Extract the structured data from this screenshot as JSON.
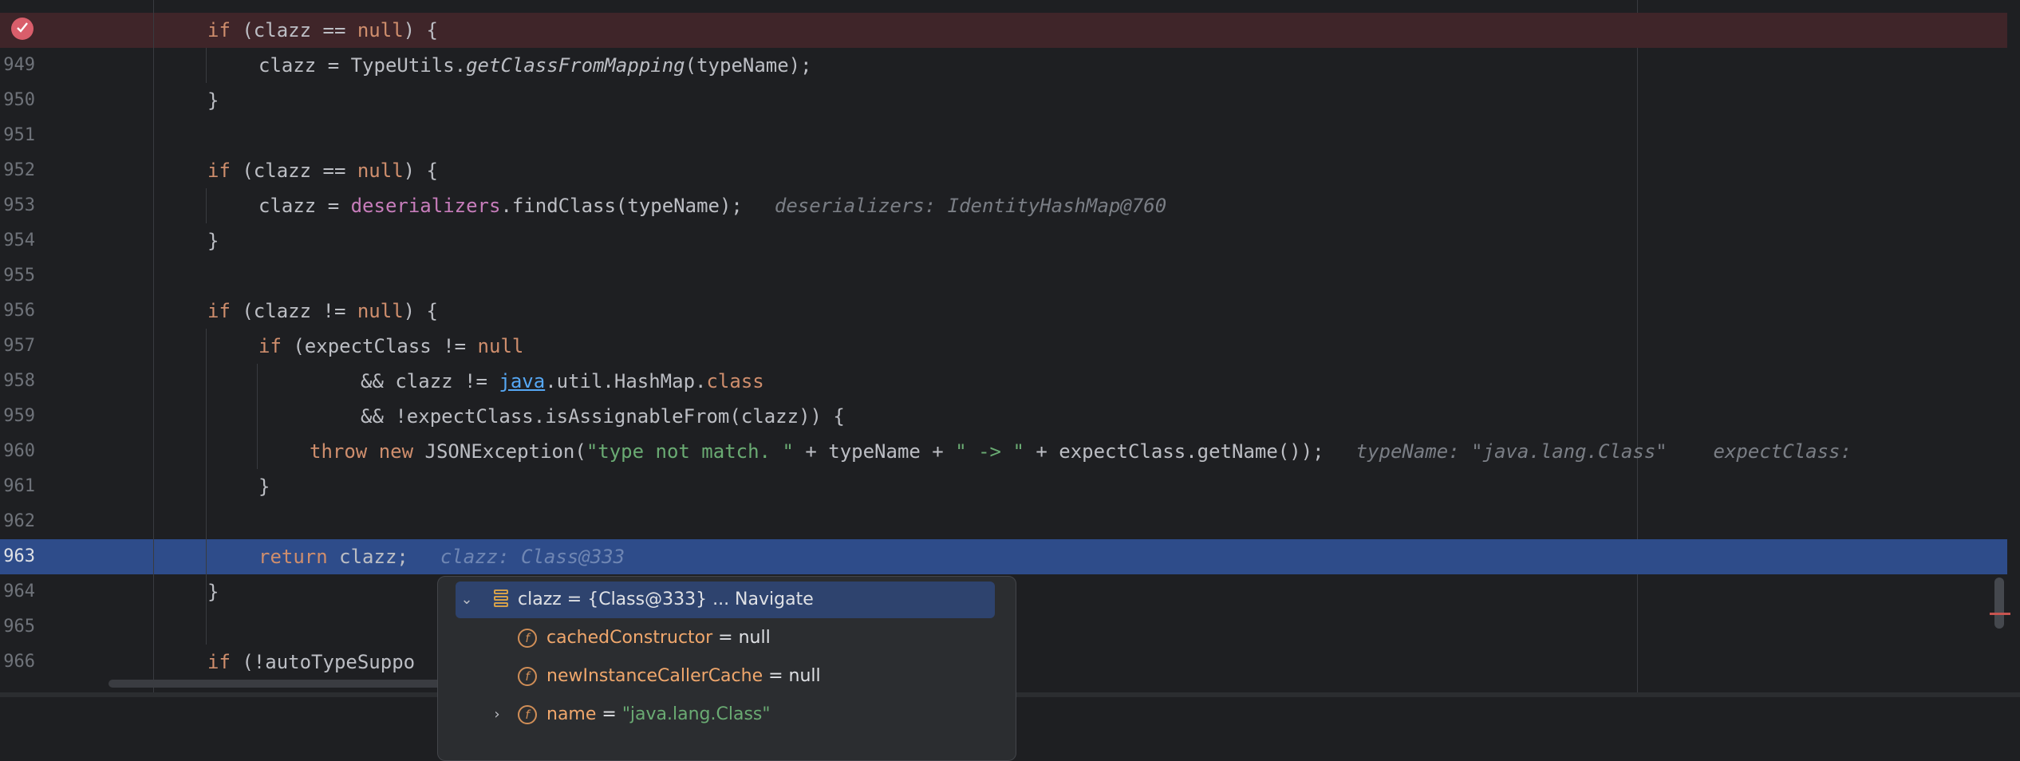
{
  "editor": {
    "lines": [
      {
        "num": "",
        "breakpoint": true
      },
      {
        "num": "949"
      },
      {
        "num": "950"
      },
      {
        "num": "951"
      },
      {
        "num": "952"
      },
      {
        "num": "953"
      },
      {
        "num": "954"
      },
      {
        "num": "955"
      },
      {
        "num": "956"
      },
      {
        "num": "957"
      },
      {
        "num": "958"
      },
      {
        "num": "959"
      },
      {
        "num": "960"
      },
      {
        "num": "961"
      },
      {
        "num": "962"
      },
      {
        "num": "963",
        "execution_point": true
      },
      {
        "num": "964"
      },
      {
        "num": "965"
      },
      {
        "num": "966"
      }
    ],
    "code": {
      "if_kw": "if",
      "return_kw": "return",
      "throw_kw": "throw",
      "new_kw": "new",
      "null_kw": "null",
      "class_kw": "class",
      "l948_rest": "(clazz == ",
      "l948_end": ") {",
      "l949_a": "clazz = TypeUtils.",
      "l949_method": "getClassFromMapping",
      "l949_b": "(typeName);",
      "brace_close": "}",
      "l952_rest": "(clazz == ",
      "l952_end": ") {",
      "l953_a": "clazz = ",
      "l953_field": "deserializers",
      "l953_b": ".findClass(typeName);",
      "l953_hint": "deserializers: IdentityHashMap@760",
      "l956_rest": "(clazz != ",
      "l956_end": ") {",
      "l957_rest": "(expectClass != ",
      "l958_a": "&& clazz != ",
      "l958_link": "java",
      "l958_b": ".util.HashMap.",
      "l959": "&& !expectClass.isAssignableFrom(clazz)) {",
      "l960_a": "JSONException(",
      "l960_s1": "\"type not match. \"",
      "l960_b": " + typeName + ",
      "l960_s2": "\" -> \"",
      "l960_c": " + expectClass.getName());",
      "l960_hint": "typeName: \"java.lang.Class\"    expectClass:",
      "l963_a": "clazz;",
      "l963_hint": "clazz: Class@333",
      "l966_a": "(!autoTypeSuppo"
    }
  },
  "popup": {
    "root": {
      "label": "clazz = {Class@333}",
      "navigate": "... Navigate"
    },
    "fields": [
      {
        "name": "cachedConstructor",
        "eq": " = ",
        "value": "null",
        "icon": "field-icon",
        "expandable": false
      },
      {
        "name": "newInstanceCallerCache",
        "eq": " = ",
        "value": "null",
        "icon": "field-icon",
        "expandable": false
      },
      {
        "name": "name",
        "eq": " = ",
        "value": "\"java.lang.Class\"",
        "icon": "field-icon",
        "expandable": true
      }
    ],
    "field_icon_letter": "f"
  },
  "colors": {
    "keyword": "#cf8e6d",
    "string": "#6aab73",
    "field": "#c77dbb",
    "breakpoint": "#d95e6b",
    "execution_line": "#2e4c8a"
  }
}
